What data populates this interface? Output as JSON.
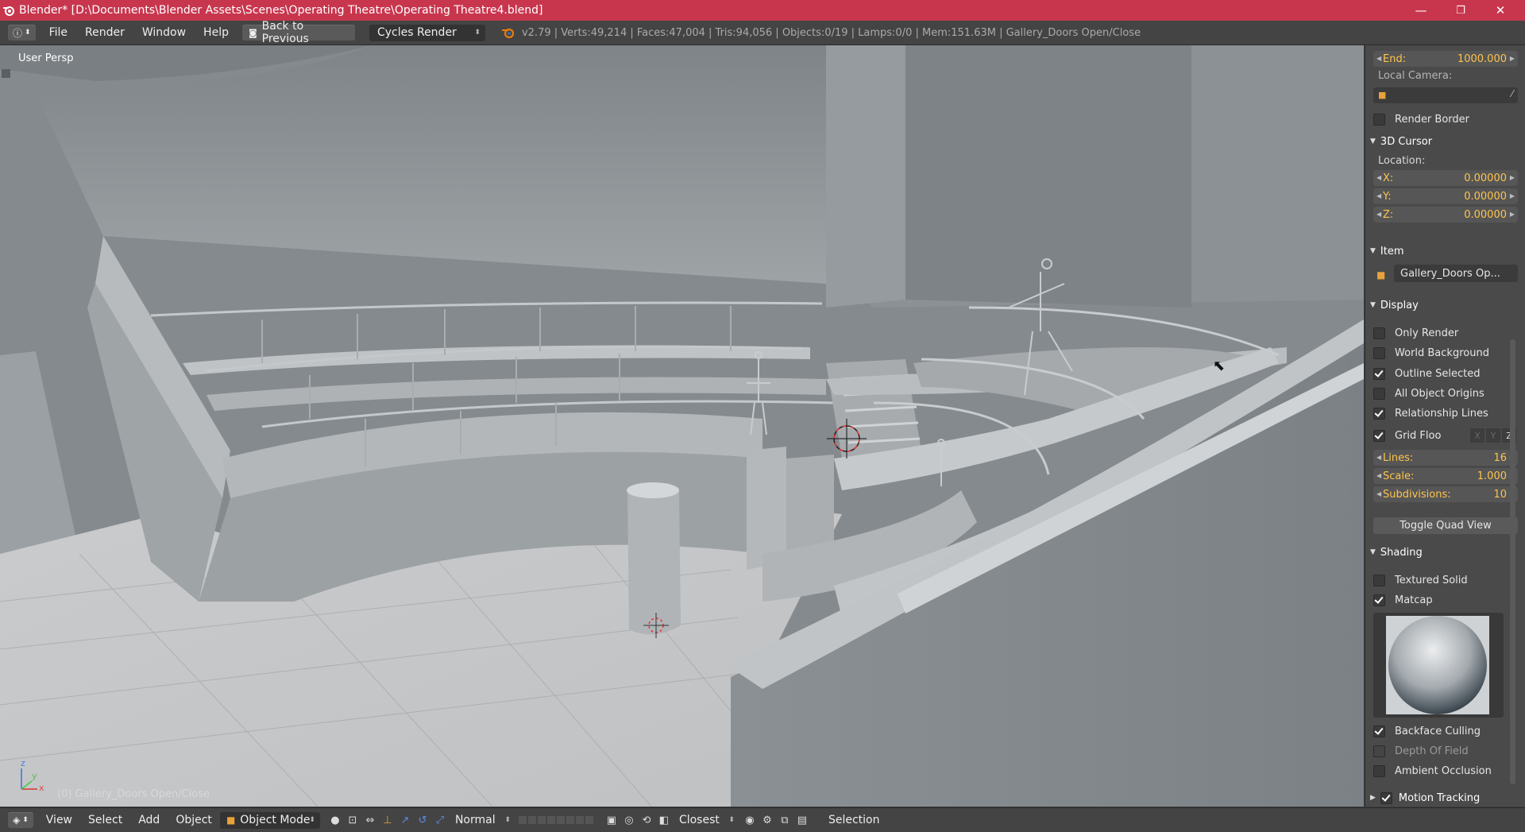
{
  "window": {
    "title": "Blender* [D:\\Documents\\Blender Assets\\Scenes\\Operating Theatre\\Operating Theatre4.blend]",
    "minimize": "—",
    "maximize": "❐",
    "close": "✕"
  },
  "menubar": {
    "menus": [
      "File",
      "Render",
      "Window",
      "Help"
    ],
    "back_button": "Back to Previous",
    "render_engine": "Cycles Render",
    "stats": "v2.79 | Verts:49,214 | Faces:47,004 | Tris:94,056 | Objects:0/19 | Lamps:0/0 | Mem:151.63M | Gallery_Doors Open/Close"
  },
  "viewport": {
    "view_label": "User Persp",
    "object_label": "(0) Gallery_Doors Open/Close",
    "axis_x": "x",
    "axis_y": "y",
    "axis_z": "z"
  },
  "npanel": {
    "end_label": "End:",
    "end_value": "1000.000",
    "local_camera_label": "Local Camera:",
    "render_border": "Render Border",
    "cursor_header": "3D Cursor",
    "location_label": "Location:",
    "cursor": [
      {
        "label": "X:",
        "value": "0.00000"
      },
      {
        "label": "Y:",
        "value": "0.00000"
      },
      {
        "label": "Z:",
        "value": "0.00000"
      }
    ],
    "item_header": "Item",
    "item_name": "Gallery_Doors Op...",
    "display_header": "Display",
    "display_options": [
      {
        "label": "Only Render",
        "checked": false
      },
      {
        "label": "World Background",
        "checked": false
      },
      {
        "label": "Outline Selected",
        "checked": true
      },
      {
        "label": "All Object Origins",
        "checked": false
      },
      {
        "label": "Relationship Lines",
        "checked": true
      }
    ],
    "grid_floor_label": "Grid Floo",
    "grid_floor_checked": true,
    "grid_axes": [
      "X",
      "Y",
      "Z"
    ],
    "grid_fields": [
      {
        "label": "Lines:",
        "value": "16"
      },
      {
        "label": "Scale:",
        "value": "1.000"
      },
      {
        "label": "Subdivisions:",
        "value": "10"
      }
    ],
    "toggle_quad_view": "Toggle Quad View",
    "shading_header": "Shading",
    "shading_options": [
      {
        "label": "Textured Solid",
        "checked": false
      },
      {
        "label": "Matcap",
        "checked": true
      }
    ],
    "after_matcap_options": [
      {
        "label": "Backface Culling",
        "checked": true,
        "enabled": true
      },
      {
        "label": "Depth Of Field",
        "checked": false,
        "enabled": false
      },
      {
        "label": "Ambient Occlusion",
        "checked": false,
        "enabled": true
      }
    ],
    "motion_tracking": "Motion Tracking",
    "motion_tracking_checked": true
  },
  "statusbar": {
    "menus": [
      "View",
      "Select",
      "Add",
      "Object"
    ],
    "mode": "Object Mode",
    "orientation": "Normal",
    "snap_target": "Closest",
    "layer_label": "Selection"
  },
  "colors": {
    "titlebar": "#c8364e",
    "accent_value": "#ffc44d",
    "panel_bg": "#4a4a4a",
    "header_bg": "#444444"
  }
}
